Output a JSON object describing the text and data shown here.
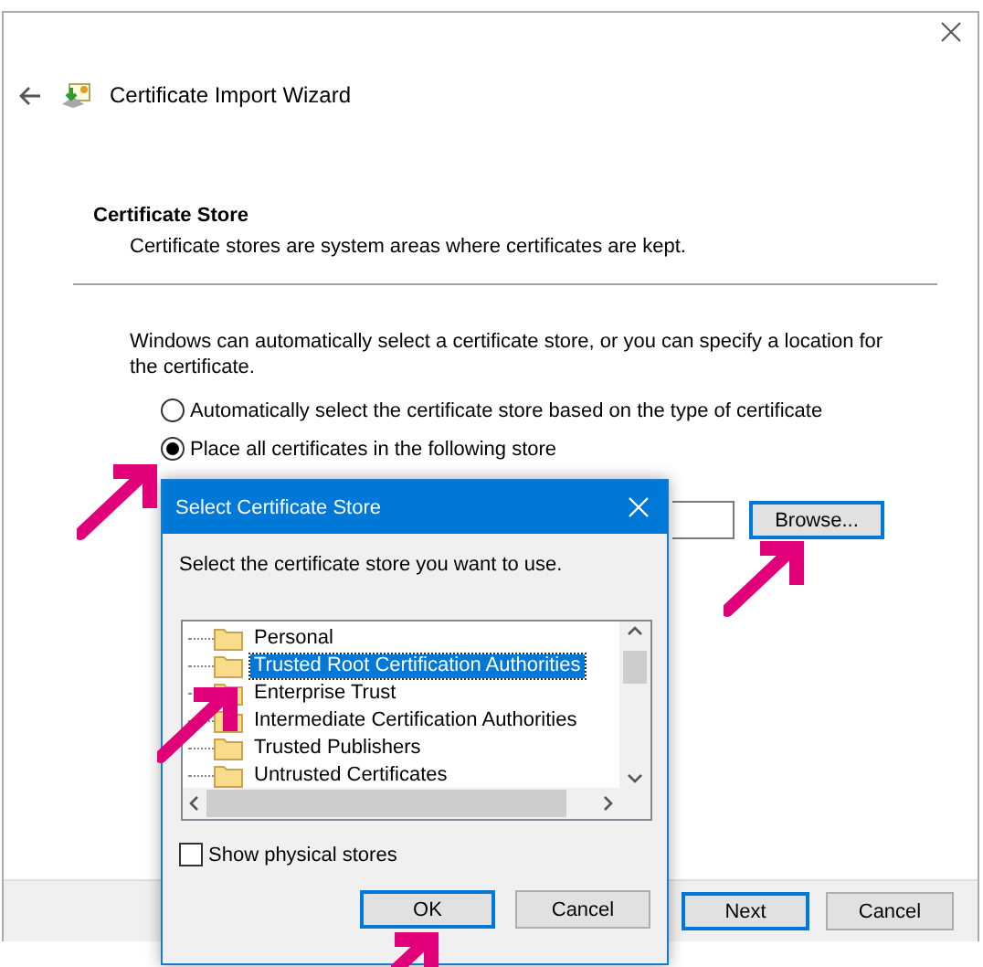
{
  "window": {
    "title": "Certificate Import Wizard"
  },
  "section": {
    "heading": "Certificate Store",
    "description": "Certificate stores are system areas where certificates are kept."
  },
  "intro": "Windows can automatically select a certificate store, or you can specify a location for the certificate.",
  "options": [
    {
      "label": "Automatically select the certificate store based on the type of certificate",
      "selected": false
    },
    {
      "label": "Place all certificates in the following store",
      "selected": true
    }
  ],
  "browse_button": "Browse...",
  "footer_buttons": [
    {
      "label": "Next",
      "default": true
    },
    {
      "label": "Cancel",
      "default": false
    }
  ],
  "dialog": {
    "title": "Select Certificate Store",
    "prompt": "Select the certificate store you want to use.",
    "stores": [
      {
        "label": "Personal",
        "selected": false
      },
      {
        "label": "Trusted Root Certification Authorities",
        "selected": true
      },
      {
        "label": "Enterprise Trust",
        "selected": false
      },
      {
        "label": "Intermediate Certification Authorities",
        "selected": false
      },
      {
        "label": "Trusted Publishers",
        "selected": false
      },
      {
        "label": "Untrusted Certificates",
        "selected": false
      }
    ],
    "show_physical": {
      "label": "Show physical stores",
      "checked": false
    },
    "buttons": [
      {
        "label": "OK",
        "default": true
      },
      {
        "label": "Cancel",
        "default": false
      }
    ]
  }
}
